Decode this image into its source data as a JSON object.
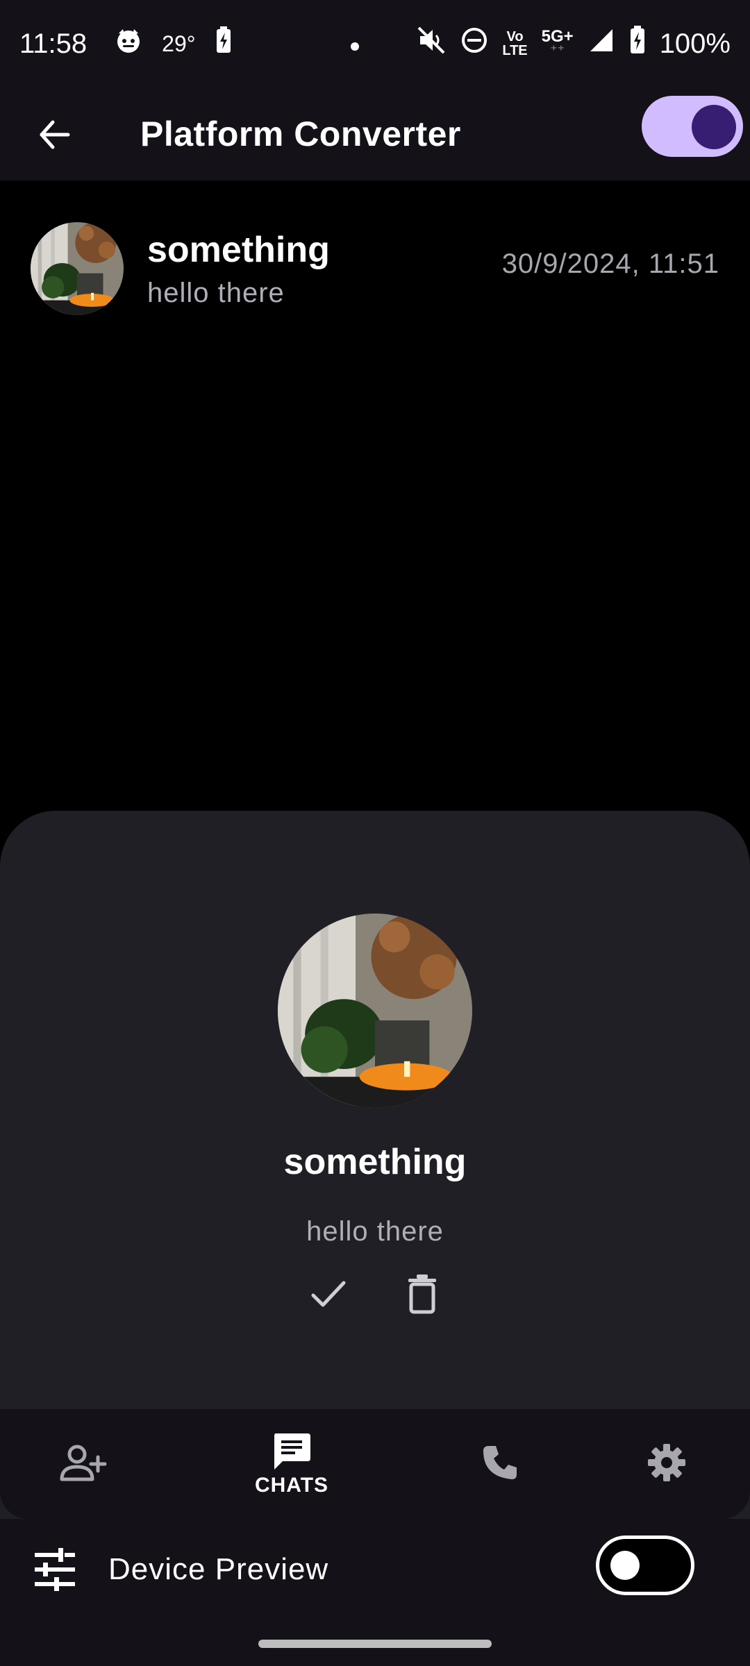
{
  "status_bar": {
    "time": "11:58",
    "temperature": "29°",
    "network_top": "Vo",
    "network_bottom": "LTE",
    "signal_top": "5G+",
    "battery": "100%"
  },
  "app_bar": {
    "title": "Platform Converter",
    "theme_toggle_on": true,
    "icons": {
      "back": "arrow-back-icon"
    }
  },
  "chats": [
    {
      "name": "something",
      "message": "hello there",
      "timestamp": "30/9/2024, 11:51"
    }
  ],
  "sheet": {
    "name": "something",
    "message": "hello there",
    "icons": {
      "confirm": "check-icon",
      "delete": "delete-icon"
    }
  },
  "bottom_nav": {
    "items": [
      {
        "icon": "person-add-icon",
        "label": ""
      },
      {
        "icon": "chat-icon",
        "label": "CHATS"
      },
      {
        "icon": "phone-icon",
        "label": ""
      },
      {
        "icon": "settings-icon",
        "label": ""
      }
    ],
    "selected": "CHATS"
  },
  "device_preview": {
    "label": "Device Preview",
    "enabled": false
  },
  "colors": {
    "background": "#000000",
    "bar": "#141218",
    "sheet": "#211f26",
    "accent": "#d0bcff",
    "accent_dark": "#381e72",
    "muted_text": "#b0aeb8"
  }
}
